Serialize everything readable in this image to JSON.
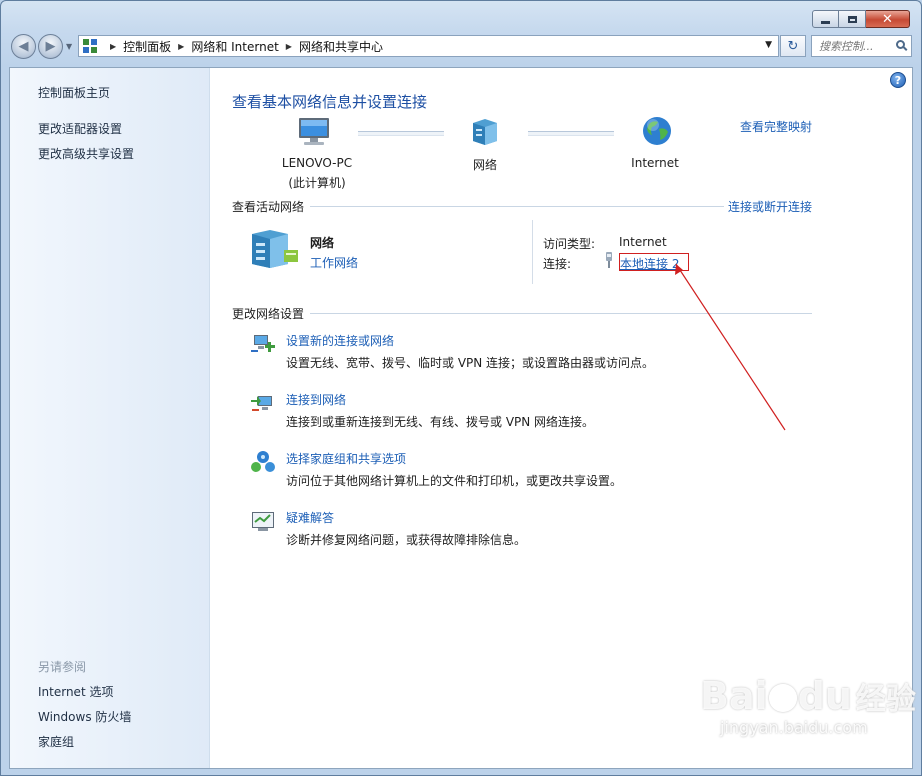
{
  "titlebar": {
    "minimize_glyph": "–",
    "maximize_glyph": "□",
    "close_glyph": "✕"
  },
  "nav": {
    "back_glyph": "◀",
    "forward_glyph": "▶",
    "recent_glyph": "▼",
    "breadcrumb": [
      "控制面板",
      "网络和 Internet",
      "网络和共享中心"
    ],
    "crumb_sep": "▶",
    "address_dropdown": "▼",
    "refresh_glyph": "↻",
    "search_placeholder": "搜索控制...",
    "icons": {
      "control_panel": "control-panel-icon",
      "search": "search-icon",
      "refresh": "refresh-icon"
    }
  },
  "sidebar": {
    "home": "控制面板主页",
    "items": [
      "更改适配器设置",
      "更改高级共享设置"
    ],
    "see_also_title": "另请参阅",
    "see_also": [
      "Internet 选项",
      "Windows 防火墙",
      "家庭组"
    ]
  },
  "help_glyph": "?",
  "main": {
    "title": "查看基本网络信息并设置连接",
    "full_map_link": "查看完整映射",
    "map": {
      "computer_name": "LENOVO-PC",
      "computer_sub": "(此计算机)",
      "network_label": "网络",
      "internet_label": "Internet",
      "icons": [
        "computer-icon",
        "network-icon",
        "globe-icon"
      ]
    },
    "active_networks": {
      "heading": "查看活动网络",
      "connect_link": "连接或断开连接",
      "network_name": "网络",
      "network_type": "工作网络",
      "access_type_label": "访问类型:",
      "access_type_value": "Internet",
      "connections_label": "连接:",
      "connection_link": "本地连接 2"
    },
    "change_settings": {
      "heading": "更改网络设置",
      "items": [
        {
          "title": "设置新的连接或网络",
          "desc": "设置无线、宽带、拨号、临时或 VPN 连接；或设置路由器或访问点。",
          "icon": "new-connection-icon"
        },
        {
          "title": "连接到网络",
          "desc": "连接到或重新连接到无线、有线、拨号或 VPN 网络连接。",
          "icon": "connect-network-icon"
        },
        {
          "title": "选择家庭组和共享选项",
          "desc": "访问位于其他网络计算机上的文件和打印机，或更改共享设置。",
          "icon": "homegroup-icon"
        },
        {
          "title": "疑难解答",
          "desc": "诊断并修复网络问题，或获得故障排除信息。",
          "icon": "troubleshoot-icon"
        }
      ]
    }
  },
  "watermark": {
    "brand": "Bai",
    "brand2": "du",
    "cn": "经验",
    "url": "jingyan.baidu.com"
  },
  "colors": {
    "link": "#1d5fb6",
    "title": "#1d4fa3",
    "annotation_red": "#d02020",
    "frame": "#bcd2ea"
  }
}
